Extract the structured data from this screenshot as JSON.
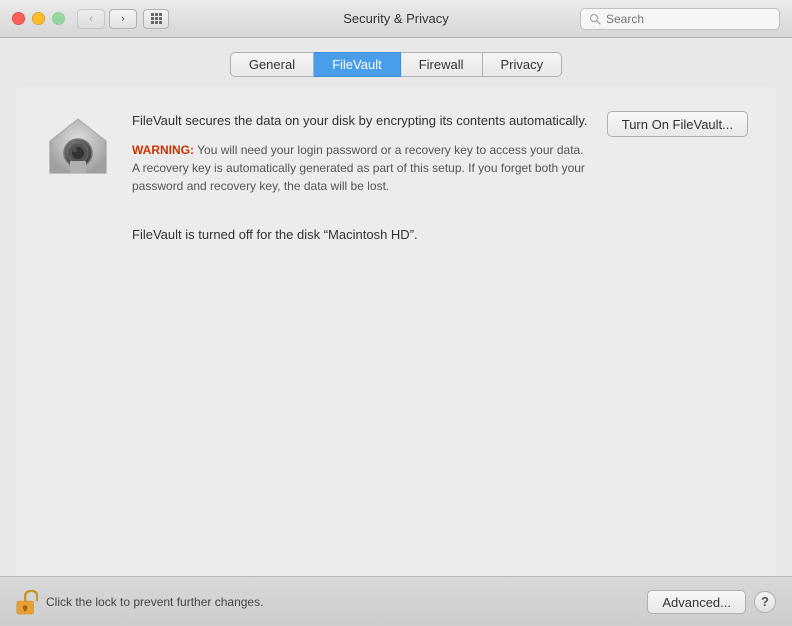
{
  "titlebar": {
    "title": "Security & Privacy",
    "back_btn": "‹",
    "forward_btn": "›"
  },
  "search": {
    "placeholder": "Search"
  },
  "tabs": [
    {
      "id": "general",
      "label": "General",
      "active": false
    },
    {
      "id": "filevault",
      "label": "FileVault",
      "active": true
    },
    {
      "id": "firewall",
      "label": "Firewall",
      "active": false
    },
    {
      "id": "privacy",
      "label": "Privacy",
      "active": false
    }
  ],
  "filevault": {
    "description": "FileVault secures the data on your disk by encrypting its contents automatically.",
    "warning_label": "WARNING:",
    "warning_text": " You will need your login password or a recovery key to access your data. A recovery key is automatically generated as part of this setup. If you forget both your password and recovery key, the data will be lost.",
    "turn_on_btn": "Turn On FileVault...",
    "status_text": "FileVault is turned off for the disk “Macintosh HD”."
  },
  "bottom_bar": {
    "lock_label": "Click the lock to prevent further changes.",
    "advanced_btn": "Advanced...",
    "help_btn": "?"
  }
}
